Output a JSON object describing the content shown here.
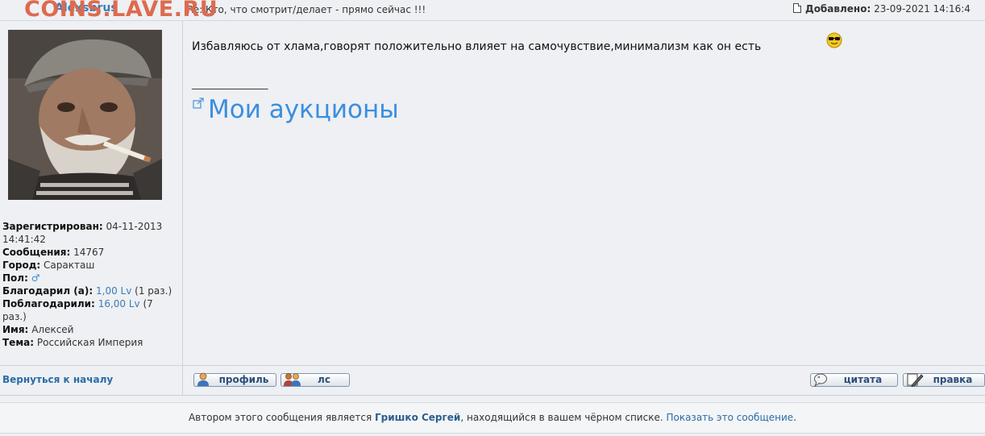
{
  "watermark": "COINS.LAVE.RU",
  "post": {
    "author": "Alexsbrus",
    "subject": "Re: Кто, что смотрит/делает - прямо сейчас !!!",
    "added_label": "Добавлено:",
    "added_value": "23-09-2021 14:16:4",
    "message": "Избавляюсь от хлама,говорят положительно влияет на самочувствие,минимализм как он есть",
    "signature_line": "_________________",
    "signature_link": "Мои аукционы",
    "smiley_icon": "cool-sunglasses-smiley-icon"
  },
  "profile": {
    "registered_label": "Зарегистрирован:",
    "registered_value": "04-11-2013 14:41:42",
    "messages_label": "Сообщения:",
    "messages_value": "14767",
    "city_label": "Город:",
    "city_value": "Саракташ",
    "gender_label": "Пол:",
    "gender_icon": "♂",
    "thanked_label": "Благодарил (а):",
    "thanked_amount": "1,00 Lv",
    "thanked_count": "(1 раз.)",
    "thanked_by_label": "Поблагодарили:",
    "thanked_by_amount": "16,00 Lv",
    "thanked_by_count": "(7 раз.)",
    "name_label": "Имя:",
    "name_value": "Алексей",
    "theme_label": "Тема:",
    "theme_value": "Российская Империя"
  },
  "actions": {
    "back_to_top": "Вернуться к началу",
    "profile": "профиль",
    "pm": "лс",
    "quote": "цитата",
    "edit": "правка"
  },
  "notice": {
    "prefix": "Автором этого сообщения является",
    "author": "Гришко Сергей",
    "middle": ", находящийся в вашем чёрном списке.",
    "link": "Показать это сообщение",
    "suffix": "."
  },
  "colors": {
    "watermark": "#dd6a4f",
    "link": "#3a7db7",
    "signature_link": "#3a8ee0",
    "background": "#eef0f3"
  }
}
